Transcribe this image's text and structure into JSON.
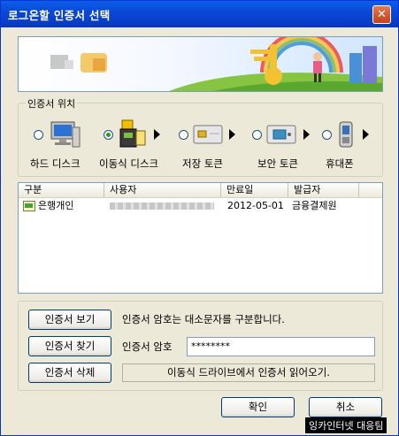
{
  "window": {
    "title": "로그온할 인증서 선택",
    "close_icon": "close-icon"
  },
  "location": {
    "group_label": "인증서 위치",
    "items": [
      {
        "label": "하드 디스크",
        "icon": "computer-icon",
        "selected": false
      },
      {
        "label": "이동식 디스크",
        "icon": "usb-drive-icon",
        "selected": true
      },
      {
        "label": "저장 토큰",
        "icon": "smartcard-token-icon",
        "selected": false
      },
      {
        "label": "보안 토큰",
        "icon": "security-token-icon",
        "selected": false
      },
      {
        "label": "휴대폰",
        "icon": "mobile-phone-icon",
        "selected": false
      }
    ]
  },
  "cert_list": {
    "columns": [
      "구분",
      "사용자",
      "만료일",
      "발급자"
    ],
    "rows": [
      {
        "type": "은행개인",
        "expiry": "2012-05-01",
        "issuer": "금융결제원"
      }
    ]
  },
  "actions": {
    "view_label": "인증서 보기",
    "find_label": "인증서 찾기",
    "delete_label": "인증서 삭제"
  },
  "password": {
    "note": "인증서 암호는 대소문자를 구분합니다.",
    "label": "인증서 암호",
    "value": "********"
  },
  "status": "이동식 드라이브에서 인증서 읽어오기.",
  "footer": {
    "ok_label": "확인",
    "cancel_label": "취소"
  },
  "tooltip": "잉카인터넷 대응팀"
}
